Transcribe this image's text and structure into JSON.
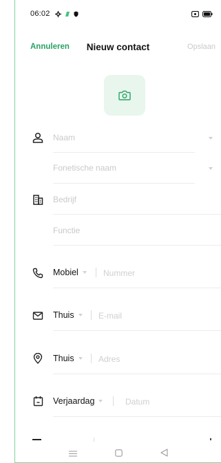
{
  "status": {
    "time": "06:02"
  },
  "header": {
    "cancel_label": "Annuleren",
    "title": "Nieuw contact",
    "save_label": "Opslaan"
  },
  "fields": {
    "name_placeholder": "Naam",
    "phonetic_placeholder": "Fonetische naam",
    "company_placeholder": "Bedrijf",
    "function_placeholder": "Functie"
  },
  "phone": {
    "type_label": "Mobiel",
    "placeholder": "Nummer"
  },
  "email": {
    "type_label": "Thuis",
    "placeholder": "E-mail"
  },
  "address": {
    "type_label": "Thuis",
    "placeholder": "Adres"
  },
  "birthday": {
    "type_label": "Verjaardag",
    "placeholder": "Datum"
  },
  "colors": {
    "accent": "#2aa265",
    "photo_bg": "#e8f6ee",
    "placeholder": "#c9c9c9",
    "divider": "#ececec"
  },
  "icons": [
    "settings-icon",
    "app-notification-icon",
    "shield-icon",
    "screen-record-icon",
    "battery-icon",
    "camera-icon",
    "person-icon",
    "building-icon",
    "phone-icon",
    "mail-icon",
    "location-pin-icon",
    "calendar-icon",
    "menu-nav-icon",
    "home-nav-icon",
    "back-nav-icon"
  ]
}
